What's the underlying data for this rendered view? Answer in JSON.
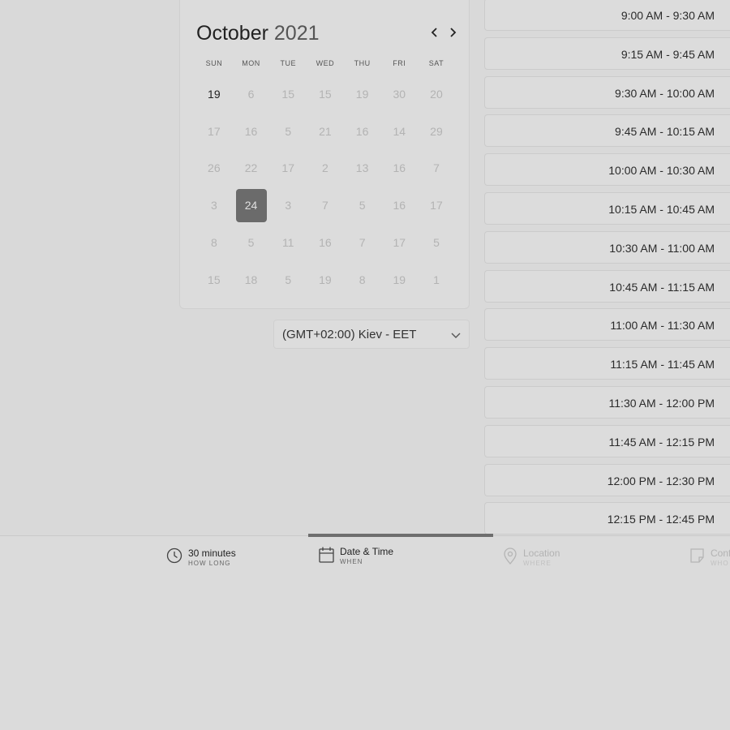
{
  "calendar": {
    "month": "October",
    "year": "2021",
    "prev_icon": "chevron-left-icon",
    "next_icon": "chevron-right-icon",
    "weekdays": [
      "SUN",
      "MON",
      "TUE",
      "WED",
      "THU",
      "FRI",
      "SAT"
    ],
    "days": [
      "19",
      "6",
      "15",
      "15",
      "19",
      "30",
      "20",
      "17",
      "16",
      "5",
      "21",
      "16",
      "14",
      "29",
      "26",
      "22",
      "17",
      "2",
      "13",
      "16",
      "7",
      "3",
      "24",
      "3",
      "7",
      "5",
      "16",
      "17",
      "8",
      "5",
      "11",
      "16",
      "7",
      "17",
      "5",
      "15",
      "18",
      "5",
      "19",
      "8",
      "19",
      "1"
    ],
    "active_day_index": 0,
    "selected_day_index": 22
  },
  "timezone": {
    "value": "(GMT+02:00) Kiev - EET",
    "icon": "chevron-down-icon"
  },
  "slots": [
    "9:00 AM - 9:30 AM",
    "9:15 AM - 9:45 AM",
    "9:30 AM - 10:00 AM",
    "9:45 AM - 10:15 AM",
    "10:00 AM - 10:30 AM",
    "10:15 AM - 10:45 AM",
    "10:30 AM - 11:00 AM",
    "10:45 AM - 11:15 AM",
    "11:00 AM - 11:30 AM",
    "11:15 AM - 11:45 AM",
    "11:30 AM - 12:00 PM",
    "11:45 AM - 12:15 PM",
    "12:00 PM - 12:30 PM",
    "12:15 PM - 12:45 PM"
  ],
  "steps": [
    {
      "title": "30 minutes",
      "sub": "HOW LONG",
      "icon": "clock-icon",
      "state": "done"
    },
    {
      "title": "Date & Time",
      "sub": "WHEN",
      "icon": "calendar-icon",
      "state": "active"
    },
    {
      "title": "Location",
      "sub": "WHERE",
      "icon": "location-pin-icon",
      "state": "disabled"
    },
    {
      "title": "Conf",
      "sub": "WHO",
      "icon": "note-icon",
      "state": "disabled"
    }
  ],
  "colors": {
    "background": "#d9d9d9",
    "selected_day": "#6b6b6b",
    "step_indicator": "#6e6e6e"
  }
}
